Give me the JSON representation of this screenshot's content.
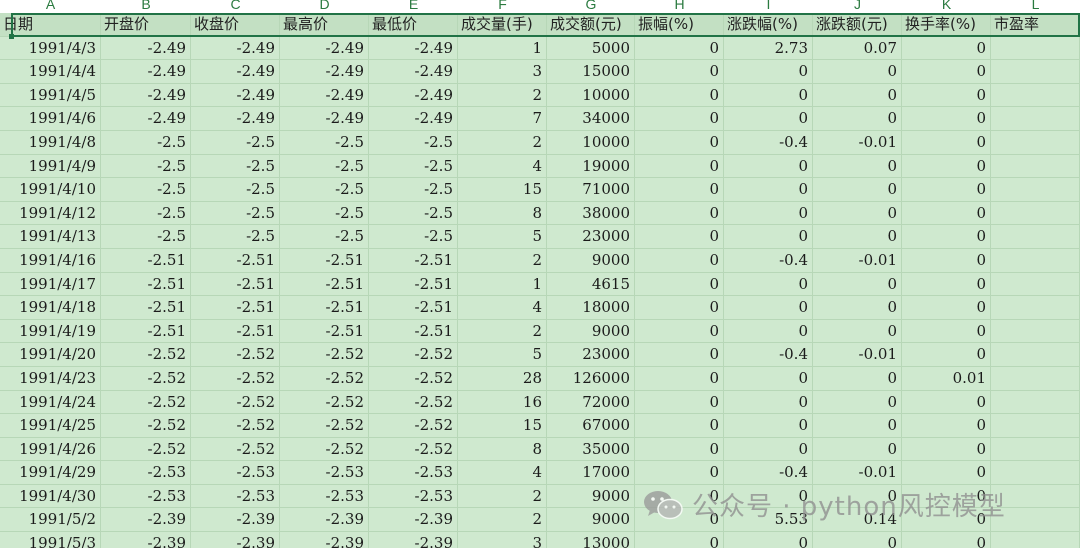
{
  "column_letters": [
    "A",
    "B",
    "C",
    "D",
    "E",
    "F",
    "G",
    "H",
    "I",
    "J",
    "K",
    "L"
  ],
  "headers": [
    "日期",
    "开盘价",
    "收盘价",
    "最高价",
    "最低价",
    "成交量(手)",
    "成交额(元)",
    "振幅(%)",
    "涨跌幅(%)",
    "涨跌额(元)",
    "换手率(%)",
    "市盈率"
  ],
  "rows": [
    [
      "1991/4/3",
      "-2.49",
      "-2.49",
      "-2.49",
      "-2.49",
      "1",
      "5000",
      "0",
      "2.73",
      "0.07",
      "0",
      ""
    ],
    [
      "1991/4/4",
      "-2.49",
      "-2.49",
      "-2.49",
      "-2.49",
      "3",
      "15000",
      "0",
      "0",
      "0",
      "0",
      ""
    ],
    [
      "1991/4/5",
      "-2.49",
      "-2.49",
      "-2.49",
      "-2.49",
      "2",
      "10000",
      "0",
      "0",
      "0",
      "0",
      ""
    ],
    [
      "1991/4/6",
      "-2.49",
      "-2.49",
      "-2.49",
      "-2.49",
      "7",
      "34000",
      "0",
      "0",
      "0",
      "0",
      ""
    ],
    [
      "1991/4/8",
      "-2.5",
      "-2.5",
      "-2.5",
      "-2.5",
      "2",
      "10000",
      "0",
      "-0.4",
      "-0.01",
      "0",
      ""
    ],
    [
      "1991/4/9",
      "-2.5",
      "-2.5",
      "-2.5",
      "-2.5",
      "4",
      "19000",
      "0",
      "0",
      "0",
      "0",
      ""
    ],
    [
      "1991/4/10",
      "-2.5",
      "-2.5",
      "-2.5",
      "-2.5",
      "15",
      "71000",
      "0",
      "0",
      "0",
      "0",
      ""
    ],
    [
      "1991/4/12",
      "-2.5",
      "-2.5",
      "-2.5",
      "-2.5",
      "8",
      "38000",
      "0",
      "0",
      "0",
      "0",
      ""
    ],
    [
      "1991/4/13",
      "-2.5",
      "-2.5",
      "-2.5",
      "-2.5",
      "5",
      "23000",
      "0",
      "0",
      "0",
      "0",
      ""
    ],
    [
      "1991/4/16",
      "-2.51",
      "-2.51",
      "-2.51",
      "-2.51",
      "2",
      "9000",
      "0",
      "-0.4",
      "-0.01",
      "0",
      ""
    ],
    [
      "1991/4/17",
      "-2.51",
      "-2.51",
      "-2.51",
      "-2.51",
      "1",
      "4615",
      "0",
      "0",
      "0",
      "0",
      ""
    ],
    [
      "1991/4/18",
      "-2.51",
      "-2.51",
      "-2.51",
      "-2.51",
      "4",
      "18000",
      "0",
      "0",
      "0",
      "0",
      ""
    ],
    [
      "1991/4/19",
      "-2.51",
      "-2.51",
      "-2.51",
      "-2.51",
      "2",
      "9000",
      "0",
      "0",
      "0",
      "0",
      ""
    ],
    [
      "1991/4/20",
      "-2.52",
      "-2.52",
      "-2.52",
      "-2.52",
      "5",
      "23000",
      "0",
      "-0.4",
      "-0.01",
      "0",
      ""
    ],
    [
      "1991/4/23",
      "-2.52",
      "-2.52",
      "-2.52",
      "-2.52",
      "28",
      "126000",
      "0",
      "0",
      "0",
      "0.01",
      ""
    ],
    [
      "1991/4/24",
      "-2.52",
      "-2.52",
      "-2.52",
      "-2.52",
      "16",
      "72000",
      "0",
      "0",
      "0",
      "0",
      ""
    ],
    [
      "1991/4/25",
      "-2.52",
      "-2.52",
      "-2.52",
      "-2.52",
      "15",
      "67000",
      "0",
      "0",
      "0",
      "0",
      ""
    ],
    [
      "1991/4/26",
      "-2.52",
      "-2.52",
      "-2.52",
      "-2.52",
      "8",
      "35000",
      "0",
      "0",
      "0",
      "0",
      ""
    ],
    [
      "1991/4/29",
      "-2.53",
      "-2.53",
      "-2.53",
      "-2.53",
      "4",
      "17000",
      "0",
      "-0.4",
      "-0.01",
      "0",
      ""
    ],
    [
      "1991/4/30",
      "-2.53",
      "-2.53",
      "-2.53",
      "-2.53",
      "2",
      "9000",
      "0",
      "0",
      "0",
      "0",
      ""
    ],
    [
      "1991/5/2",
      "-2.39",
      "-2.39",
      "-2.39",
      "-2.39",
      "2",
      "9000",
      "0",
      "5.53",
      "0.14",
      "0",
      ""
    ],
    [
      "1991/5/3",
      "-2.39",
      "-2.39",
      "-2.39",
      "-2.39",
      "3",
      "13000",
      "0",
      "0",
      "0",
      "0",
      ""
    ]
  ],
  "watermark": {
    "icon": "wechat-icon",
    "text": "公众号 · python风控模型",
    "color": "#8f8f8f"
  },
  "colors": {
    "sheet_fill": "#cfe9cf",
    "header_fill": "#c3e0c3",
    "gridline": "#b7d7b7",
    "selection_border": "#217346",
    "column_letter": "#2a7a3f"
  }
}
